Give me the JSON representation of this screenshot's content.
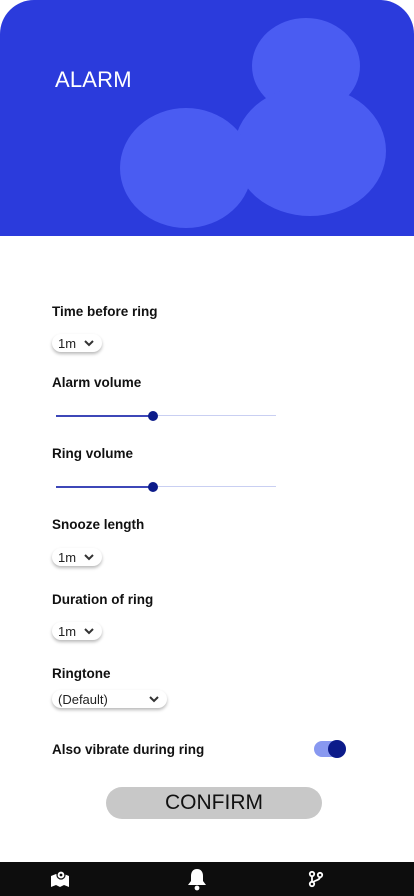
{
  "header": {
    "title": "ALARM"
  },
  "settings": {
    "time_before_ring": {
      "label": "Time before ring",
      "value": "1m"
    },
    "alarm_volume": {
      "label": "Alarm volume",
      "level": 0.44
    },
    "ring_volume": {
      "label": "Ring volume",
      "level": 0.44
    },
    "snooze_length": {
      "label": "Snooze length",
      "value": "1m"
    },
    "duration_of_ring": {
      "label": "Duration of ring",
      "value": "1m"
    },
    "ringtone": {
      "label": "Ringtone",
      "value": "(Default)"
    },
    "vibrate": {
      "label": "Also vibrate during ring",
      "on": true
    }
  },
  "confirm": {
    "label": "CONFIRM"
  },
  "bottom_nav": {
    "items": [
      {
        "icon": "map-icon"
      },
      {
        "icon": "bell-icon"
      },
      {
        "icon": "branch-icon"
      }
    ]
  },
  "colors": {
    "header_bg": "#2b3bdc",
    "header_blob": "#4a5cf2",
    "accent": "#0c1b8a",
    "nav_bg": "#0d0d0d"
  }
}
